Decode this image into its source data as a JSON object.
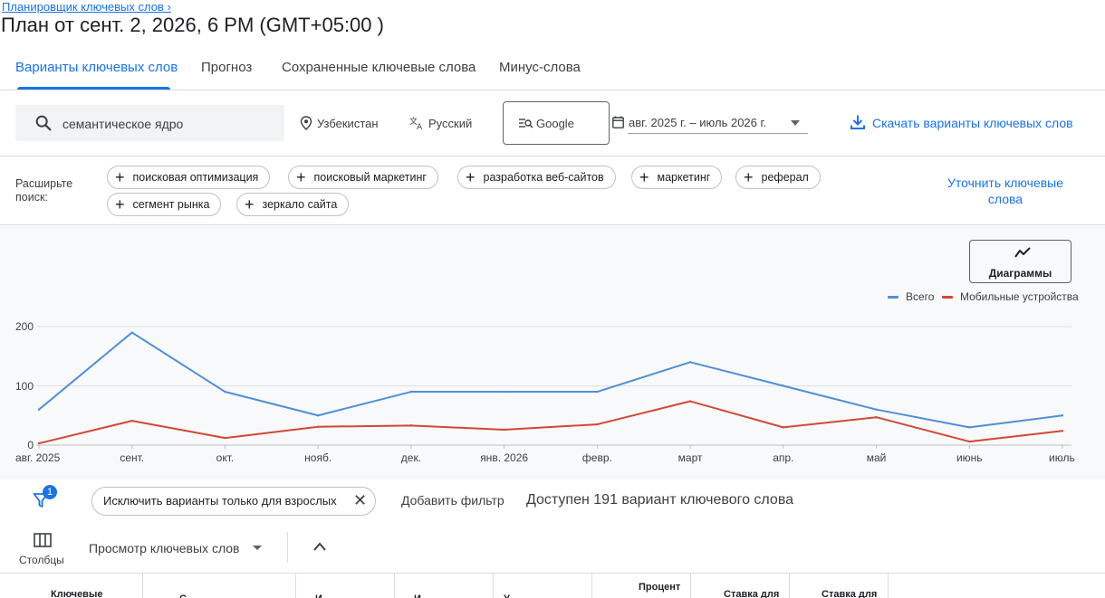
{
  "breadcrumb": "Планировщик ключевых слов",
  "breadcrumb_chevron": "›",
  "title": "План от сент. 2, 2026, 6 PM (GMT+05:00 )",
  "tabs": [
    {
      "label": "Варианты ключевых слов",
      "active": true
    },
    {
      "label": "Прогноз",
      "active": false
    },
    {
      "label": "Сохраненные ключевые слова",
      "active": false
    },
    {
      "label": "Минус-слова",
      "active": false
    }
  ],
  "search": {
    "value": "семантическое ядро",
    "icon": "search-icon"
  },
  "location": {
    "label": "Узбекистан",
    "icon": "location-pin-icon"
  },
  "language": {
    "label": "Русский",
    "icon": "translate-icon"
  },
  "network": {
    "label": "Google",
    "icon": "search-network-icon"
  },
  "date_range": {
    "label": "авг. 2025 г. – июль 2026 г.",
    "icon": "calendar-icon"
  },
  "download": {
    "label": "Скачать варианты ключевых слов",
    "icon": "download-icon"
  },
  "expand": {
    "label": "Расширьте поиск:",
    "chips": [
      "поисковая оптимизация",
      "поисковый маркетинг",
      "разработка веб-сайтов",
      "маркетинг",
      "реферал",
      "сегмент рынка",
      "зеркало сайта"
    ],
    "refine_label": "Уточнить ключевые слова"
  },
  "chart_toggle": {
    "label": "Диаграммы",
    "icon": "trend-line-icon"
  },
  "colors": {
    "accent": "#1a73e8",
    "total_series": "#4e8fd6",
    "mobile_series": "#d14836"
  },
  "chart_data": {
    "type": "line",
    "x": [
      "авг. 2025",
      "сент.",
      "окт.",
      "нояб.",
      "дек.",
      "янв. 2026",
      "февр.",
      "март",
      "апр.",
      "май",
      "июнь",
      "июль"
    ],
    "series": [
      {
        "name": "Всего",
        "values": [
          60,
          190,
          90,
          50,
          90,
          90,
          90,
          140,
          100,
          60,
          30,
          50
        ]
      },
      {
        "name": "Мобильные устройства",
        "values": [
          3,
          41,
          12,
          31,
          33,
          26,
          35,
          74,
          30,
          47,
          6,
          24
        ]
      }
    ],
    "yticks": [
      "0",
      "100",
      "200"
    ],
    "ylim": [
      0,
      200
    ],
    "grid": true,
    "legend": "top-right"
  },
  "filters": {
    "badge_count": "1",
    "chip_label": "Исключить варианты только для взрослых",
    "add_filter": "Добавить фильтр",
    "available": "Доступен 191 вариант ключевого слова"
  },
  "columns_label": "Столбцы",
  "view_label": "Просмотр ключевых слов",
  "table_headers": [
    "Ключевые",
    "С",
    "И",
    "И",
    "У",
    "Процент",
    "Ставка для",
    "Ставка для"
  ]
}
